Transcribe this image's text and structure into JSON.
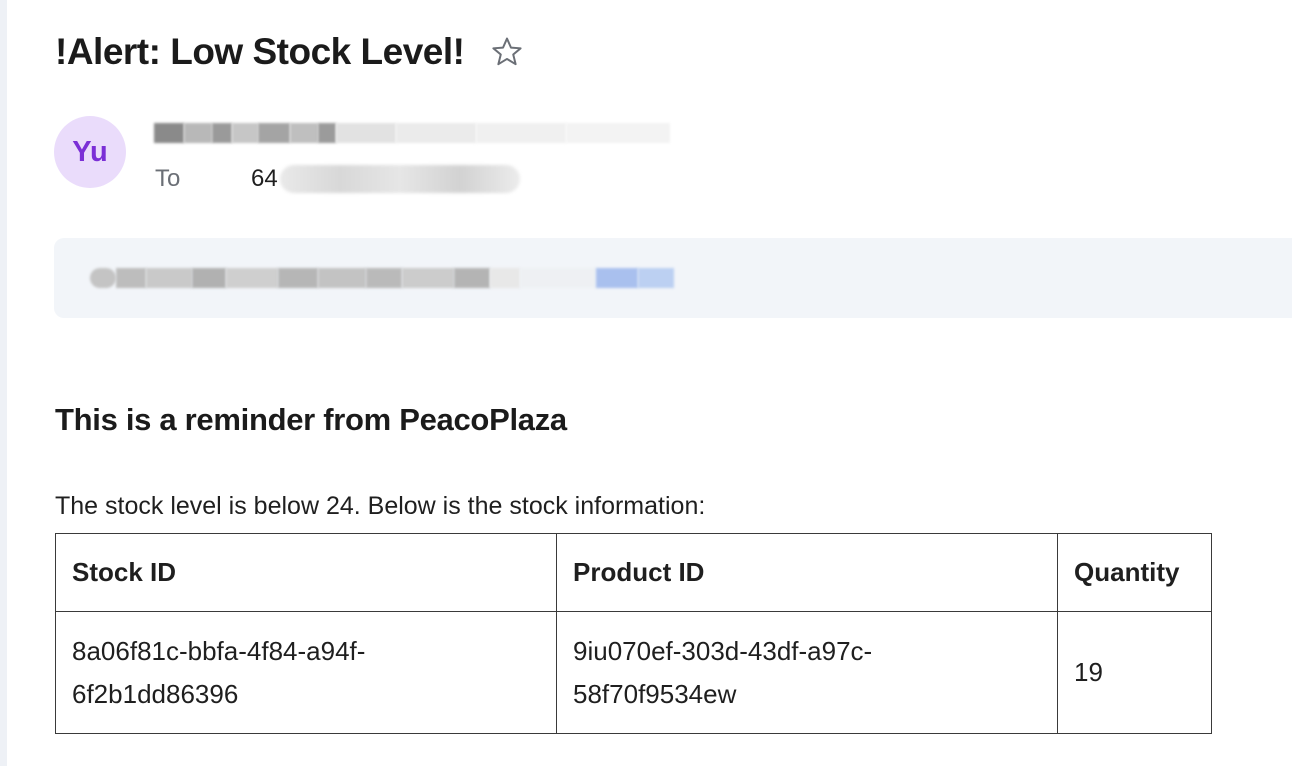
{
  "email": {
    "subject": "!Alert: Low Stock Level!",
    "star_icon": "star-outline-icon",
    "avatar_initials": "Yu",
    "to_label": "To",
    "to_value_visible": "64"
  },
  "body": {
    "heading": "This is a reminder from PeacoPlaza",
    "intro": "The stock level is below 24. Below is the stock information:",
    "table": {
      "headers": [
        "Stock ID",
        "Product ID",
        "Quantity"
      ],
      "rows": [
        [
          "8a06f81c-bbfa-4f84-a94f-6f2b1dd86396",
          "9iu070ef-303d-43df-a97c-58f70f9534ew",
          "19"
        ]
      ]
    }
  },
  "colors": {
    "avatar_bg": "#eadcfb",
    "avatar_text": "#7b2fd6",
    "translate_bar_bg": "#f2f5f9"
  }
}
